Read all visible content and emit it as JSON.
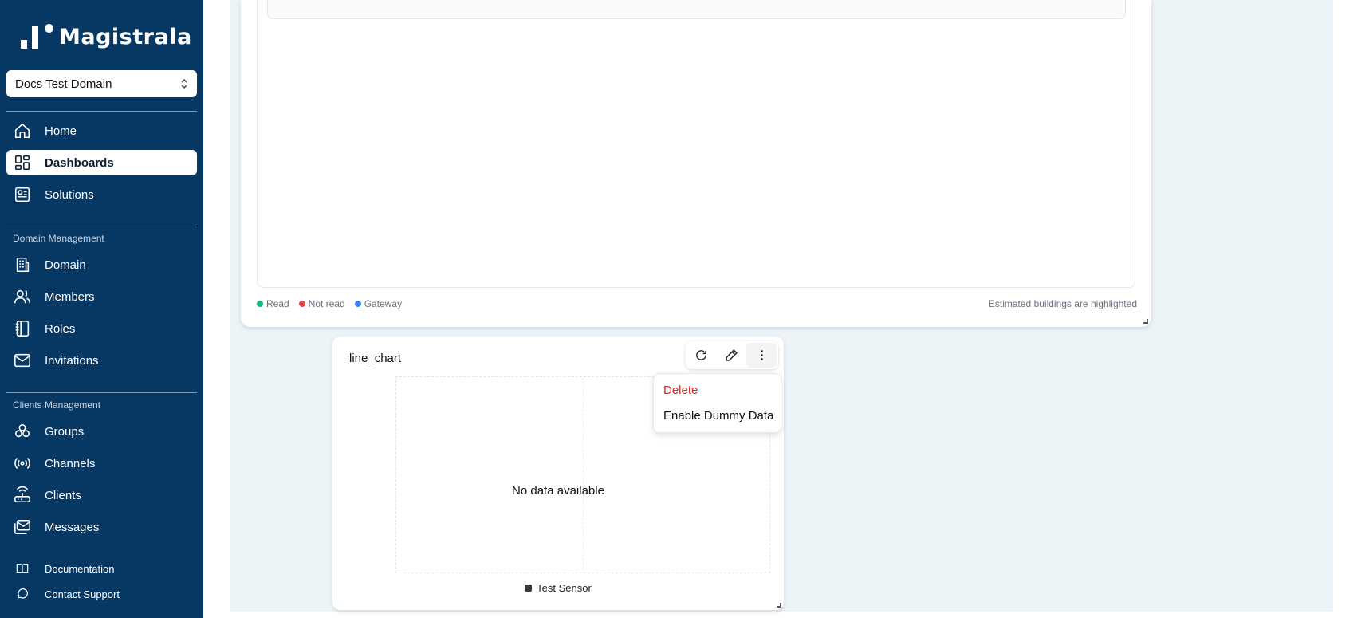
{
  "brand": {
    "name": "Magistrala"
  },
  "domain_selector": {
    "value": "Docs Test Domain"
  },
  "sidebar": {
    "main": [
      {
        "label": "Home",
        "icon": "home-icon"
      },
      {
        "label": "Dashboards",
        "icon": "dashboard-icon",
        "active": true
      },
      {
        "label": "Solutions",
        "icon": "solutions-icon"
      }
    ],
    "domain_section": {
      "title": "Domain Management",
      "items": [
        {
          "label": "Domain",
          "icon": "building-icon"
        },
        {
          "label": "Members",
          "icon": "users-icon"
        },
        {
          "label": "Roles",
          "icon": "notebook-icon"
        },
        {
          "label": "Invitations",
          "icon": "mail-icon"
        }
      ]
    },
    "clients_section": {
      "title": "Clients Management",
      "items": [
        {
          "label": "Groups",
          "icon": "groups-icon"
        },
        {
          "label": "Channels",
          "icon": "broadcast-icon"
        },
        {
          "label": "Clients",
          "icon": "router-icon"
        },
        {
          "label": "Messages",
          "icon": "messages-icon"
        }
      ]
    },
    "footer": [
      {
        "label": "Documentation",
        "icon": "book-icon"
      },
      {
        "label": "Contact Support",
        "icon": "chat-icon"
      }
    ]
  },
  "map_widget": {
    "legend": [
      {
        "label": "Read",
        "color": "#10b981"
      },
      {
        "label": "Not read",
        "color": "#ef4444"
      },
      {
        "label": "Gateway",
        "color": "#3b82f6"
      }
    ],
    "note": "Estimated buildings are highlighted"
  },
  "chart_widget": {
    "title": "line_chart",
    "empty_message": "No data available",
    "legend_label": "Test Sensor",
    "menu": {
      "delete": "Delete",
      "enable_dummy": "Enable Dummy Data"
    }
  }
}
